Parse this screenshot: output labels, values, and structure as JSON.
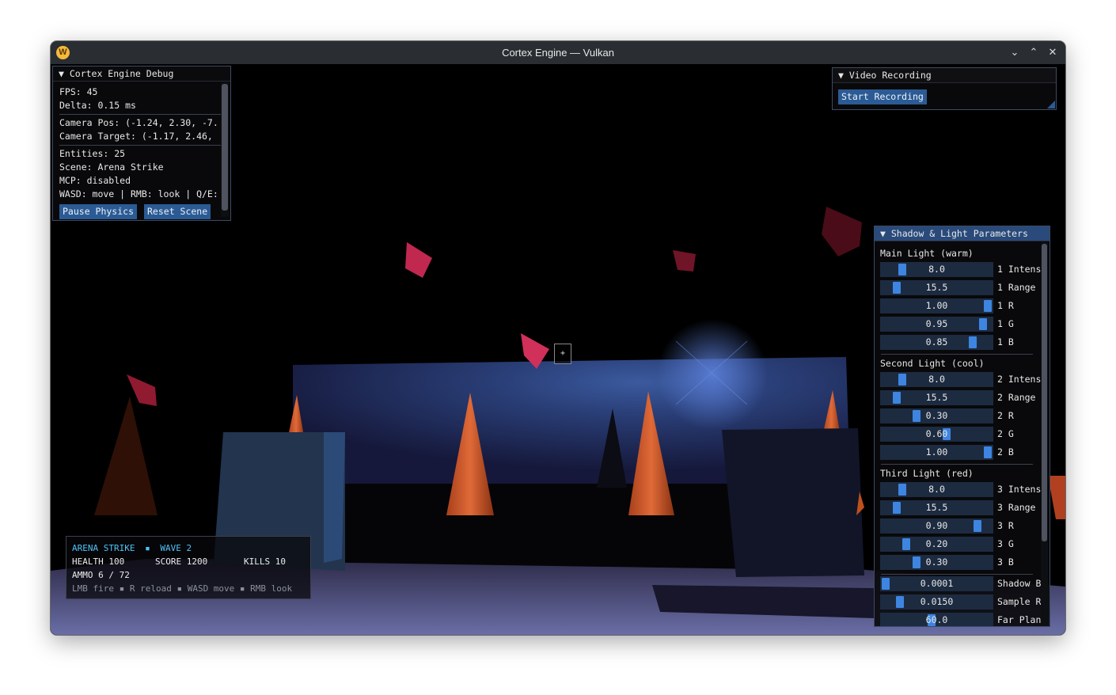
{
  "window": {
    "title": "Cortex Engine — Vulkan",
    "app_icon": "W",
    "controls": {
      "minimize": "⌄",
      "maximize": "⌃",
      "close": "✕"
    }
  },
  "debug_panel": {
    "title": "▼ Cortex Engine Debug",
    "fps": "FPS: 45",
    "delta": "Delta: 0.15 ms",
    "camera_pos": "Camera Pos: (-1.24, 2.30, -7.",
    "camera_target": "Camera Target: (-1.17, 2.46,",
    "entities": "Entities: 25",
    "scene": "Scene: Arena Strike",
    "mcp": "MCP: disabled",
    "controls": "WASD: move | RMB: look | Q/E:",
    "pause_button": "Pause Physics",
    "reset_button": "Reset Scene"
  },
  "video_panel": {
    "title": "▼ Video Recording",
    "start_button": "Start Recording"
  },
  "light_panel": {
    "title": "▼ Shadow & Light Parameters",
    "sections": [
      {
        "title": "Main Light (warm)",
        "sliders": [
          {
            "value": "8.0",
            "label": "1 Intens",
            "fraction": 0.16
          },
          {
            "value": "15.5",
            "label": "1 Range",
            "fraction": 0.11
          },
          {
            "value": "1.00",
            "label": "1 R",
            "fraction": 1.0
          },
          {
            "value": "0.95",
            "label": "1 G",
            "fraction": 0.95
          },
          {
            "value": "0.85",
            "label": "1 B",
            "fraction": 0.85
          }
        ]
      },
      {
        "title": "Second Light (cool)",
        "sliders": [
          {
            "value": "8.0",
            "label": "2 Intens",
            "fraction": 0.16
          },
          {
            "value": "15.5",
            "label": "2 Range",
            "fraction": 0.11
          },
          {
            "value": "0.30",
            "label": "2 R",
            "fraction": 0.3
          },
          {
            "value": "0.60",
            "label": "2 G",
            "fraction": 0.6
          },
          {
            "value": "1.00",
            "label": "2 B",
            "fraction": 1.0
          }
        ]
      },
      {
        "title": "Third Light (red)",
        "sliders": [
          {
            "value": "8.0",
            "label": "3 Intens",
            "fraction": 0.16
          },
          {
            "value": "15.5",
            "label": "3 Range",
            "fraction": 0.11
          },
          {
            "value": "0.90",
            "label": "3 R",
            "fraction": 0.9
          },
          {
            "value": "0.20",
            "label": "3 G",
            "fraction": 0.2
          },
          {
            "value": "0.30",
            "label": "3 B",
            "fraction": 0.3
          }
        ]
      }
    ],
    "shadow_sliders": [
      {
        "value": "0.0001",
        "label": "Shadow B",
        "fraction": 0.0
      },
      {
        "value": "0.0150",
        "label": "Sample R",
        "fraction": 0.14
      },
      {
        "value": "60.0",
        "label": "Far Plan",
        "fraction": 0.45
      }
    ]
  },
  "hud": {
    "title": "ARENA STRIKE",
    "bullet": "▪",
    "wave": "WAVE 2",
    "health": "HEALTH 100",
    "score": "SCORE  1200",
    "kills": "KILLS 10",
    "ammo": "AMMO  6 / 72",
    "hint": "LMB fire ▪ R reload ▪ WASD move ▪ RMB look",
    "accent_color": "#4fc3f7"
  },
  "crosshair": "+",
  "colors": {
    "titlebar": "#2a2e32",
    "button": "#2b5b95",
    "slider_grab": "#3d85e0",
    "slider_track": "#1d2b41"
  }
}
